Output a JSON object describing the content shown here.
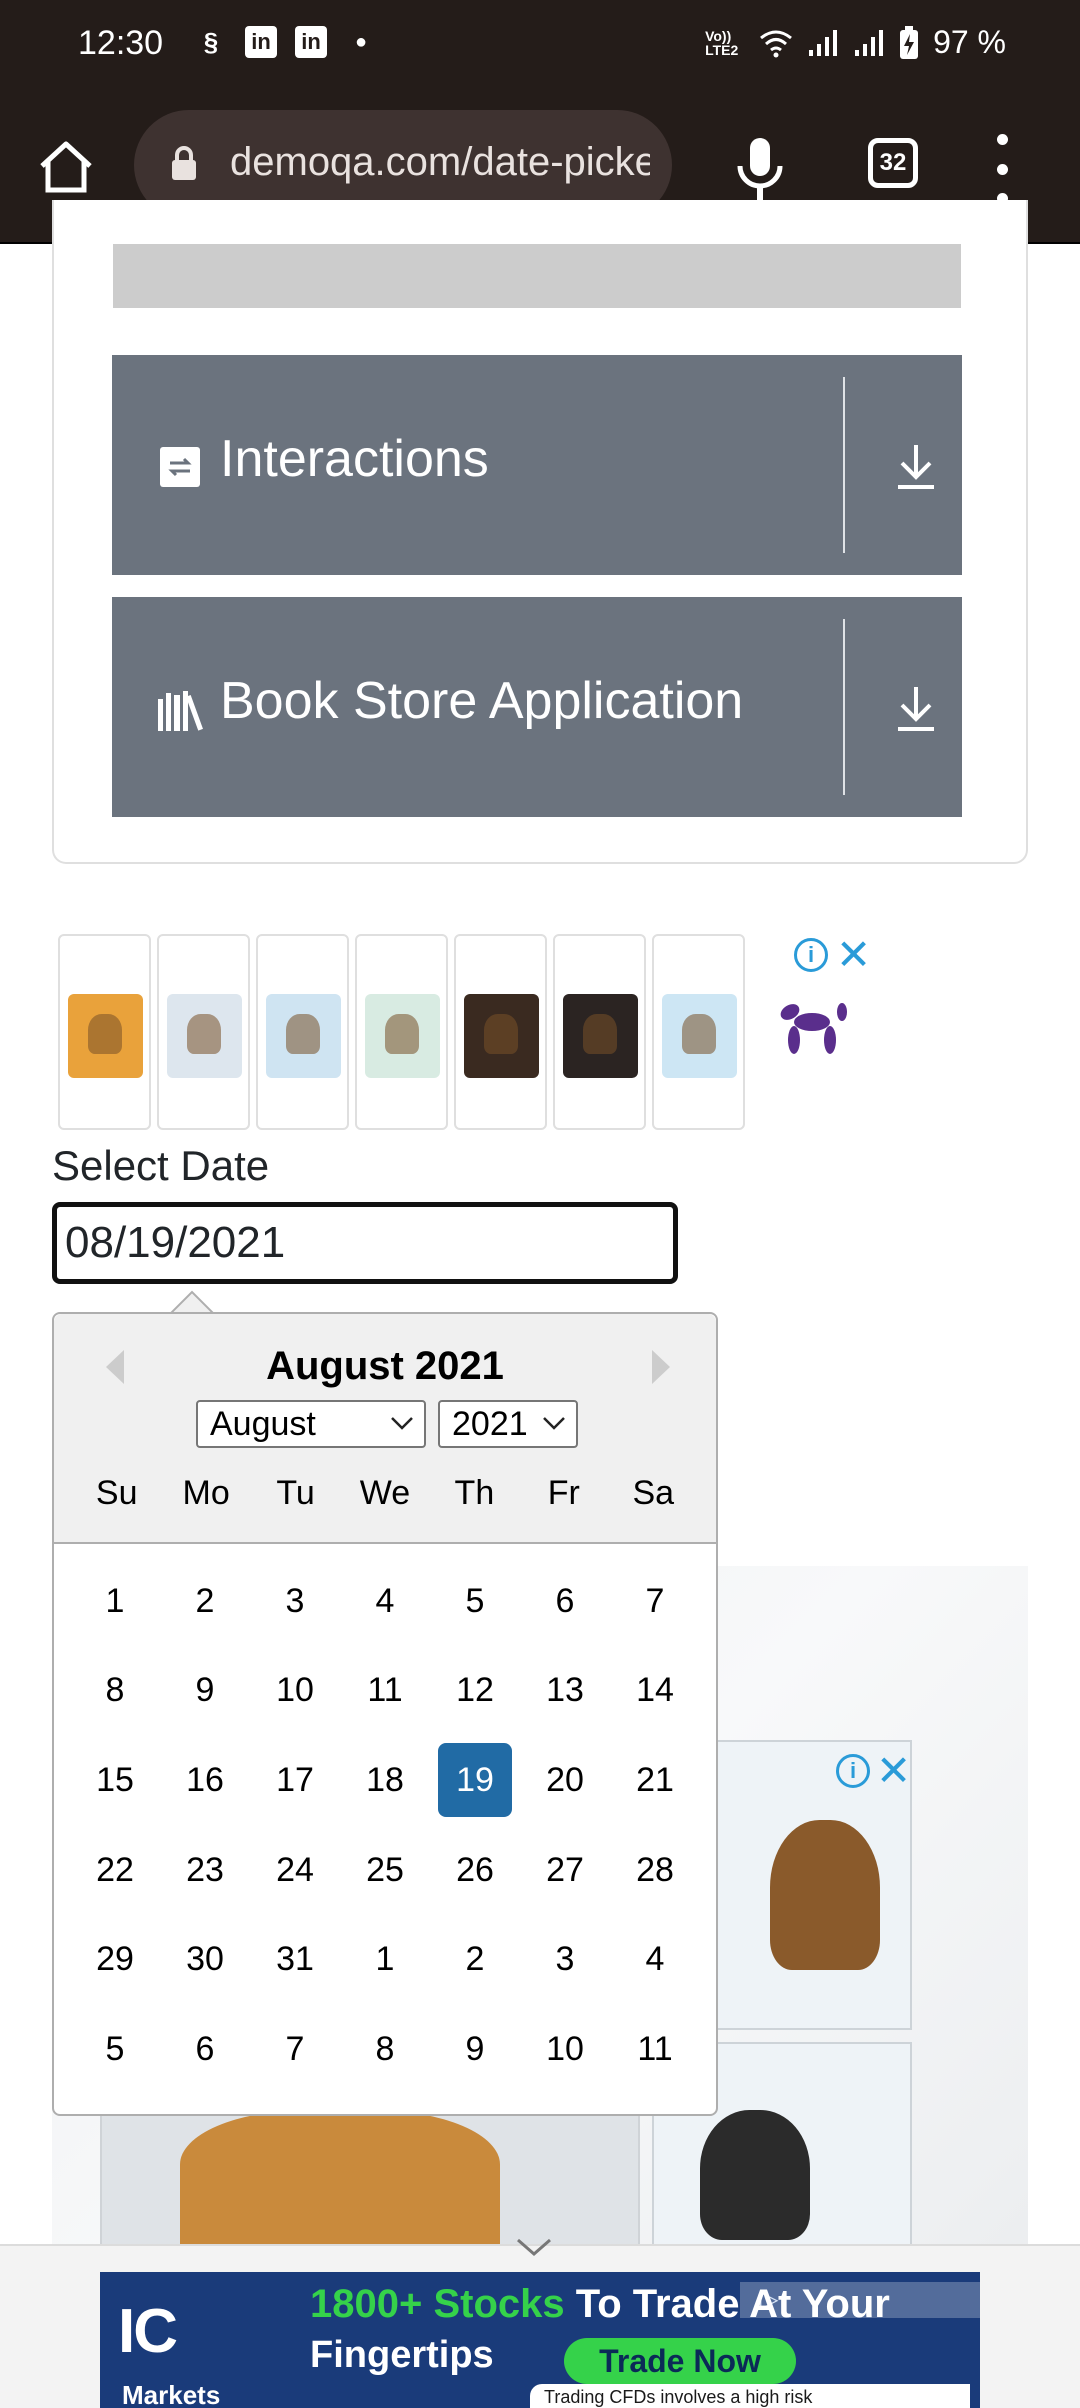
{
  "status_bar": {
    "time": "12:30",
    "network_label": "Vo)) LTE2",
    "battery": "97 %"
  },
  "browser": {
    "url": "demoqa.com/date-picker",
    "tab_count": "32"
  },
  "menu": {
    "items": [
      {
        "label": "Interactions",
        "icon": "interactions-icon"
      },
      {
        "label": "Book Store Application",
        "icon": "book-store-icon"
      }
    ]
  },
  "form": {
    "label": "Select Date",
    "date_value": "08/19/2021"
  },
  "datepicker": {
    "title": "August 2021",
    "month_select": "August",
    "year_select": "2021",
    "weekdays": [
      "Su",
      "Mo",
      "Tu",
      "We",
      "Th",
      "Fr",
      "Sa"
    ],
    "weeks": [
      [
        "1",
        "2",
        "3",
        "4",
        "5",
        "6",
        "7"
      ],
      [
        "8",
        "9",
        "10",
        "11",
        "12",
        "13",
        "14"
      ],
      [
        "15",
        "16",
        "17",
        "18",
        "19",
        "20",
        "21"
      ],
      [
        "22",
        "23",
        "24",
        "25",
        "26",
        "27",
        "28"
      ],
      [
        "29",
        "30",
        "31",
        "1",
        "2",
        "3",
        "4"
      ],
      [
        "5",
        "6",
        "7",
        "8",
        "9",
        "10",
        "11"
      ]
    ],
    "selected_day": "19",
    "selected_color": "#216ba5"
  },
  "bottom_ad": {
    "logo": "IC",
    "logo_sub": "Markets",
    "headline_green": "1800+ Stocks",
    "headline_white": " To Trade At Your",
    "line2": "Fingertips",
    "cta": "Trade Now",
    "disclaimer": "Trading CFDs involves a high risk"
  },
  "colors": {
    "browser_bg": "#241c19",
    "accordion_bg": "#6b737e",
    "ad_blue": "#2a9bd8"
  }
}
